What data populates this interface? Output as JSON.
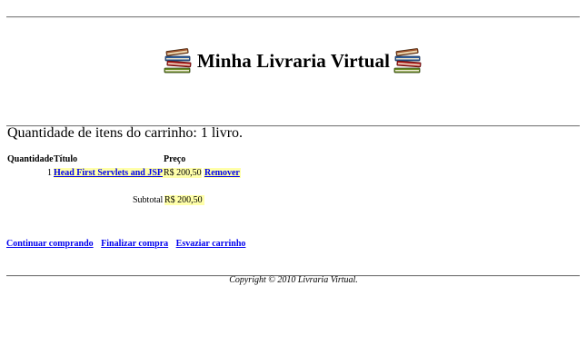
{
  "header": {
    "title": "Minha Livraria Virtual",
    "left_icon": "books-icon",
    "right_icon": "books-icon"
  },
  "cart": {
    "count_text": "Quantidade de itens do carrinho: 1 livro.",
    "columns": {
      "quantity": "Quantidade",
      "title": "Título",
      "price": "Preço"
    },
    "items": [
      {
        "quantity": "1",
        "title": "Head First Servlets and JSP",
        "price": "R$ 200,50",
        "remove_label": "Remover"
      }
    ],
    "subtotal_label": "Subtotal",
    "subtotal_value": "R$ 200,50"
  },
  "actions": {
    "continue_label": "Continuar comprando",
    "checkout_label": "Finalizar compra",
    "empty_label": "Esvaziar carrinho"
  },
  "footer": {
    "copyright": "Copyright © 2010 Livraria Virtual."
  },
  "colors": {
    "link": "#0000ee",
    "highlight": "#ffffaa",
    "rule": "#808080"
  }
}
